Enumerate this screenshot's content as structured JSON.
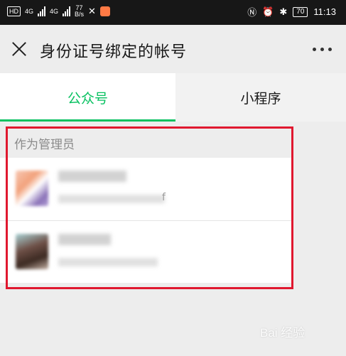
{
  "status_bar": {
    "hd": "HD",
    "net1": "4G",
    "net2": "4G",
    "speed_value": "77",
    "speed_unit": "B/s",
    "battery": "70",
    "time": "11:13"
  },
  "header": {
    "title": "身份证号绑定的帐号"
  },
  "tabs": [
    {
      "label": "公众号",
      "active": true
    },
    {
      "label": "小程序",
      "active": false
    }
  ],
  "section": {
    "label": "作为管理员"
  },
  "accounts": [
    {
      "name": "",
      "description": "",
      "trailing": "f"
    },
    {
      "name": "",
      "description": "",
      "trailing": ""
    }
  ],
  "watermark": "Bai 经验",
  "colors": {
    "accent": "#07c160",
    "highlight": "#e0182f",
    "background": "#ededed"
  }
}
